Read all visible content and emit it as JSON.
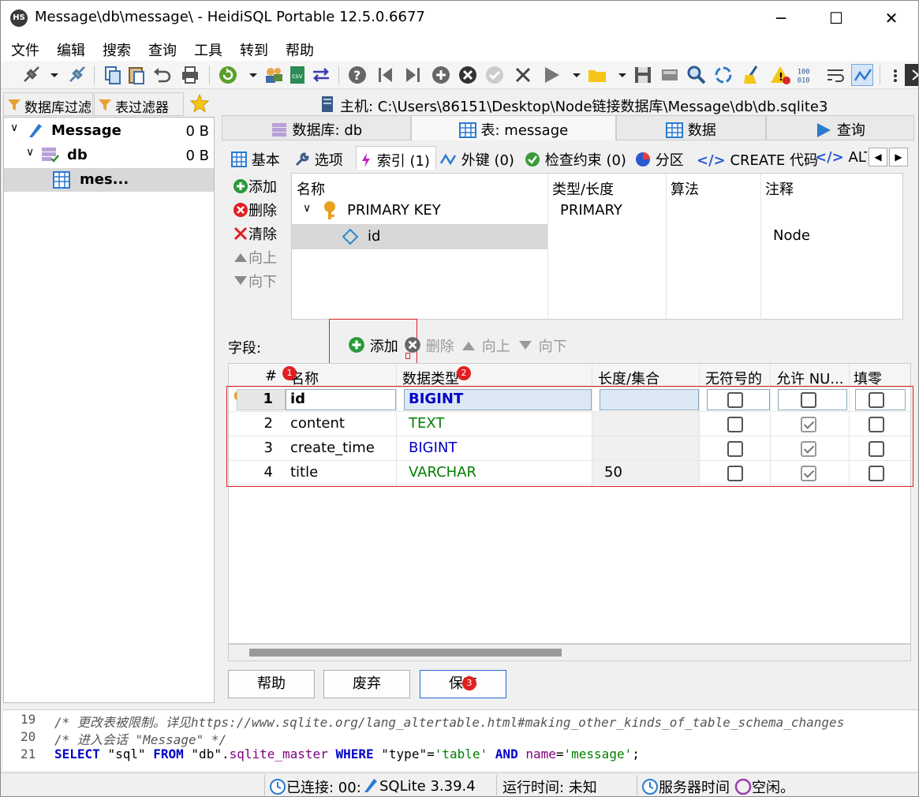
{
  "window": {
    "title": "Message\\db\\message\\ - HeidiSQL Portable 12.5.0.6677",
    "icon_text": "HS",
    "minimize_glyph": "─",
    "maximize_glyph": "☐",
    "close_glyph": "✕"
  },
  "menu": [
    "文件",
    "编辑",
    "搜索",
    "查询",
    "工具",
    "转到",
    "帮助"
  ],
  "toolbar_icons": [
    "connect-plug-icon",
    "disconnect-plug-icon",
    "copy-icon",
    "paste-icon",
    "undo-icon",
    "print-icon",
    "refresh-icon",
    "user-manager-icon",
    "csv-export-icon",
    "transfer-icon",
    "help-icon",
    "first-record-icon",
    "last-record-icon",
    "add-record-icon",
    "delete-record-icon",
    "post-record-icon",
    "cancel-record-icon",
    "run-query-icon",
    "open-folder-icon",
    "save-icon",
    "disk-icon",
    "search-icon",
    "replace-icon",
    "clear-icon",
    "warning-icon",
    "binary-icon",
    "wrap-icon",
    "sync-icon",
    "more-icon"
  ],
  "left_panel": {
    "db_filter_label": "数据库过滤",
    "table_filter_label": "表过滤器",
    "tree": [
      {
        "label": "Message",
        "size": "0 B"
      },
      {
        "label": "db",
        "size": "0 B"
      },
      {
        "label": "mes...",
        "size": ""
      }
    ]
  },
  "host_label": "主机: C:\\Users\\86151\\Desktop\\Node链接数据库\\Message\\db\\db.sqlite3",
  "main_tabs": [
    "数据库: db",
    "表: message",
    "数据",
    "查询"
  ],
  "sub_tabs": [
    "基本",
    "选项",
    "索引 (1)",
    "外键 (0)",
    "检查约束 (0)",
    "分区",
    "CREATE 代码",
    "ALTER"
  ],
  "sub_tab_scroll": {
    "left": "◀",
    "right": "▶"
  },
  "index_tools": {
    "add": "添加",
    "delete": "删除",
    "clear": "清除",
    "up": "向上",
    "down": "向下"
  },
  "index_grid": {
    "headers": [
      "名称",
      "类型/长度",
      "算法",
      "注释"
    ],
    "primary_key": {
      "name": "PRIMARY KEY",
      "type": "PRIMARY"
    },
    "column": {
      "name": "id",
      "comment": "Node"
    }
  },
  "fields": {
    "label": "字段:",
    "toolbar": {
      "add": "添加",
      "delete": "删除",
      "up": "向上",
      "down": "向下"
    },
    "headers": [
      "#",
      "名称",
      "数据类型",
      "长度/集合",
      "无符号的",
      "允许 NU...",
      "填零"
    ],
    "rows": [
      {
        "num": "1",
        "name": "id",
        "type": "BIGINT",
        "type_color": "#0000c8",
        "length": "",
        "unsigned": false,
        "allow_null": false,
        "zerofill": false,
        "pk": true
      },
      {
        "num": "2",
        "name": "content",
        "type": "TEXT",
        "type_color": "#008000",
        "length": "",
        "unsigned": false,
        "allow_null": true,
        "zerofill": false,
        "pk": false
      },
      {
        "num": "3",
        "name": "create_time",
        "type": "BIGINT",
        "type_color": "#0000c8",
        "length": "",
        "unsigned": false,
        "allow_null": true,
        "zerofill": false,
        "pk": false
      },
      {
        "num": "4",
        "name": "title",
        "type": "VARCHAR",
        "type_color": "#008000",
        "length": "50",
        "unsigned": false,
        "allow_null": true,
        "zerofill": false,
        "pk": false
      }
    ]
  },
  "bottom_buttons": {
    "help": "帮助",
    "discard": "废弃",
    "save": "保存"
  },
  "badges": [
    "1",
    "2",
    "3"
  ],
  "sql_log": [
    {
      "num": "19",
      "text": "/* 更改表被限制。详见https://www.sqlite.org/lang_altertable.html#making_other_kinds_of_table_schema_changes"
    },
    {
      "num": "20",
      "text": "/* 进入会话 \"Message\" */"
    },
    {
      "num": "21",
      "parts": [
        {
          "t": "SELECT",
          "c": "kw"
        },
        {
          "t": " ",
          "c": ""
        },
        {
          "t": "\"sql\"",
          "c": "qt"
        },
        {
          "t": " ",
          "c": ""
        },
        {
          "t": "FROM",
          "c": "kw"
        },
        {
          "t": " ",
          "c": ""
        },
        {
          "t": "\"db\"",
          "c": "qt"
        },
        {
          "t": ".",
          "c": ""
        },
        {
          "t": "sqlite_master",
          "c": "nm"
        },
        {
          "t": " ",
          "c": ""
        },
        {
          "t": "WHERE",
          "c": "kw"
        },
        {
          "t": " ",
          "c": ""
        },
        {
          "t": "\"type\"",
          "c": "qt"
        },
        {
          "t": "=",
          "c": ""
        },
        {
          "t": "'table'",
          "c": "st"
        },
        {
          "t": " ",
          "c": ""
        },
        {
          "t": "AND",
          "c": "kw"
        },
        {
          "t": " ",
          "c": ""
        },
        {
          "t": "name",
          "c": "nm"
        },
        {
          "t": "=",
          "c": ""
        },
        {
          "t": "'message'",
          "c": "st"
        },
        {
          "t": ";",
          "c": ""
        }
      ]
    }
  ],
  "status": {
    "connected": "已连接: 00:",
    "server": "SQLite 3.39.4",
    "uptime": "运行时间: 未知",
    "server_time": "服务器时间",
    "idle": "空闲。"
  }
}
